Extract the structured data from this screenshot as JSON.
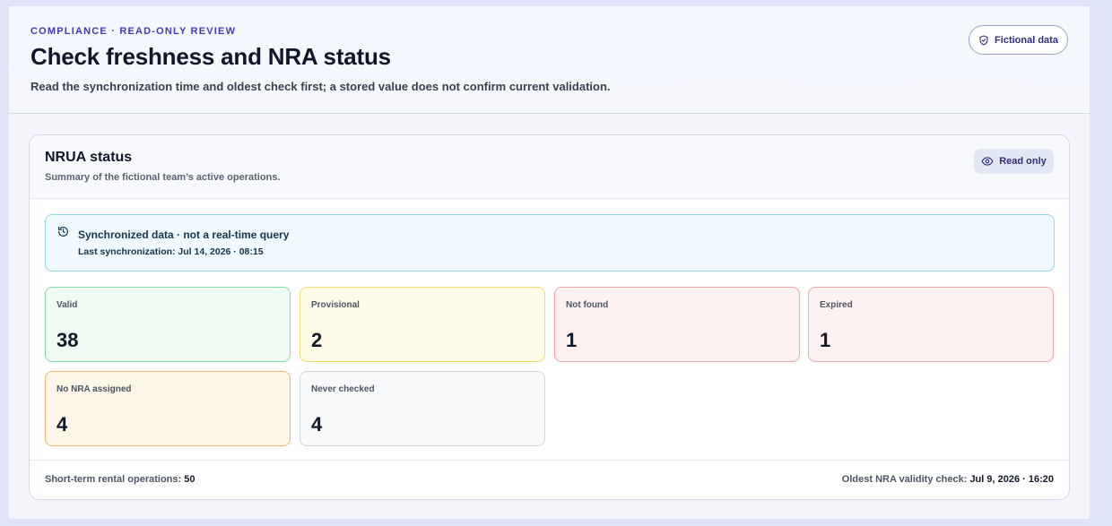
{
  "header": {
    "eyebrow": "COMPLIANCE · READ-ONLY REVIEW",
    "title": "Check freshness and NRA status",
    "subtitle": "Read the synchronization time and oldest check first; a stored value does not confirm current validation.",
    "badge": {
      "label": "Fictional data",
      "icon": "shield-check-icon"
    }
  },
  "card": {
    "title": "NRUA status",
    "subtitle": "Summary of the fictional team’s active operations.",
    "readonly": {
      "label": "Read only",
      "icon": "eye-icon"
    },
    "sync": {
      "icon": "history-icon",
      "title": "Synchronized data · not a real-time query",
      "last_sync": "Last synchronization: Jul 14, 2026 · 08:15"
    },
    "stats": [
      {
        "label": "Valid",
        "value": "38",
        "status": "success",
        "color": "#86dca5"
      },
      {
        "label": "Provisional",
        "value": "2",
        "status": "warning",
        "color": "#f0df6f"
      },
      {
        "label": "Not found",
        "value": "1",
        "status": "danger",
        "color": "#eca7a7"
      },
      {
        "label": "Expired",
        "value": "1",
        "status": "danger",
        "color": "#eca7a7"
      },
      {
        "label": "No NRA assigned",
        "value": "4",
        "status": "attention",
        "color": "#f0b86a"
      },
      {
        "label": "Never checked",
        "value": "4",
        "status": "neutral",
        "color": "#d2d7df"
      }
    ],
    "footer": {
      "operations_label": "Short-term rental operations:",
      "operations_value": "50",
      "oldest_label": "Oldest NRA validity check:",
      "oldest_value": "Jul 9, 2026 · 16:20"
    }
  },
  "colors": {
    "accent": "#3f3bb8",
    "info_border": "#8fd6e6",
    "page_background": "#dfe4f8"
  }
}
